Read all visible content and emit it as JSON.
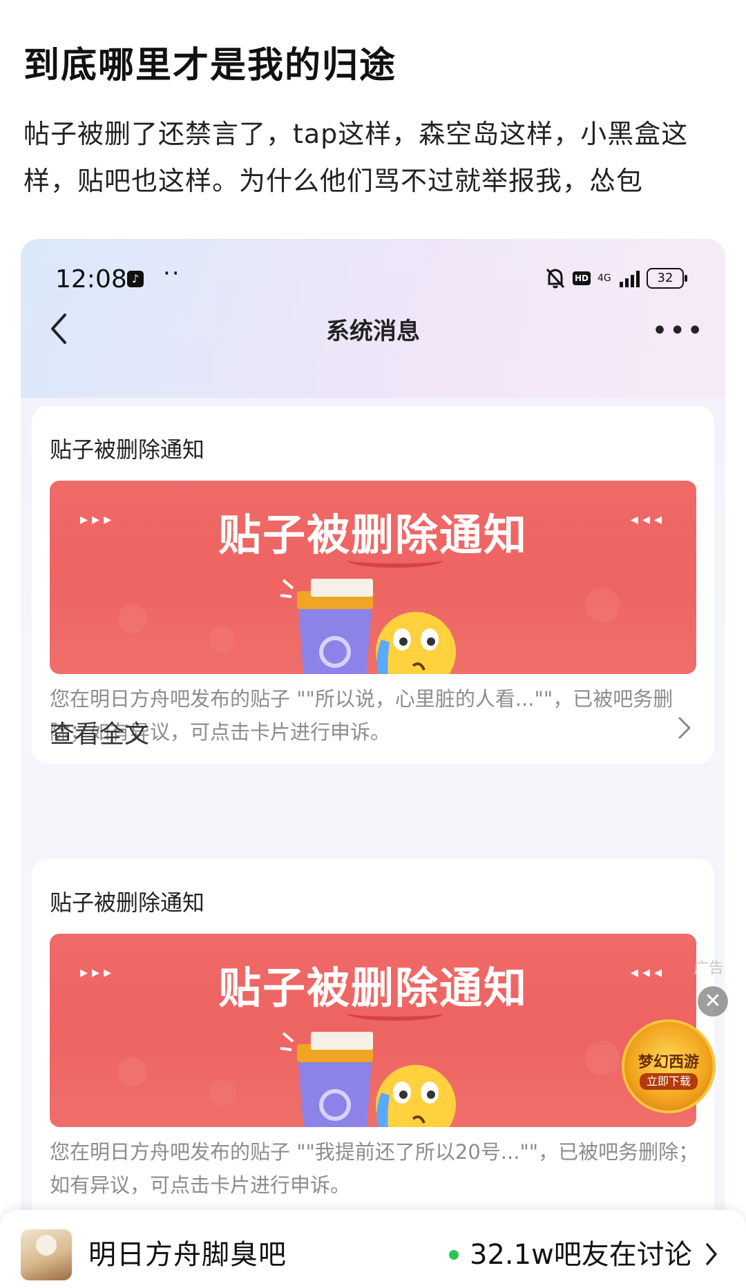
{
  "post": {
    "title": "到底哪里才是我的归途",
    "body": "帖子被删了还禁言了，tap这样，森空岛这样，小黑盒这样，贴吧也这样。为什么他们骂不过就举报我，怂包"
  },
  "screenshot": {
    "status_bar": {
      "time": "12:08",
      "dots": "··",
      "network": "4G",
      "battery": "32"
    },
    "nav": {
      "title": "系统消息"
    },
    "cards": [
      {
        "title": "贴子被删除通知",
        "banner_heading": "贴子被删除通知",
        "text": "您在明日方舟吧发布的贴子 \"\"所以说，心里脏的人看...\"\"，已被吧务删除；如有异议，可点击卡片进行申诉。",
        "link": "查看全文"
      },
      {
        "title": "贴子被删除通知",
        "banner_heading": "贴子被删除通知",
        "text": "您在明日方舟吧发布的贴子 \"\"我提前还了所以20号...\"\"，已被吧务删除；如有异议，可点击卡片进行申诉。"
      }
    ]
  },
  "ad": {
    "tag": "广告",
    "game_name": "梦幻西游",
    "cta": "立即下载"
  },
  "bottom_bar": {
    "forum_name": "明日方舟脚臭吧",
    "discussion": "32.1w吧友在讨论"
  }
}
